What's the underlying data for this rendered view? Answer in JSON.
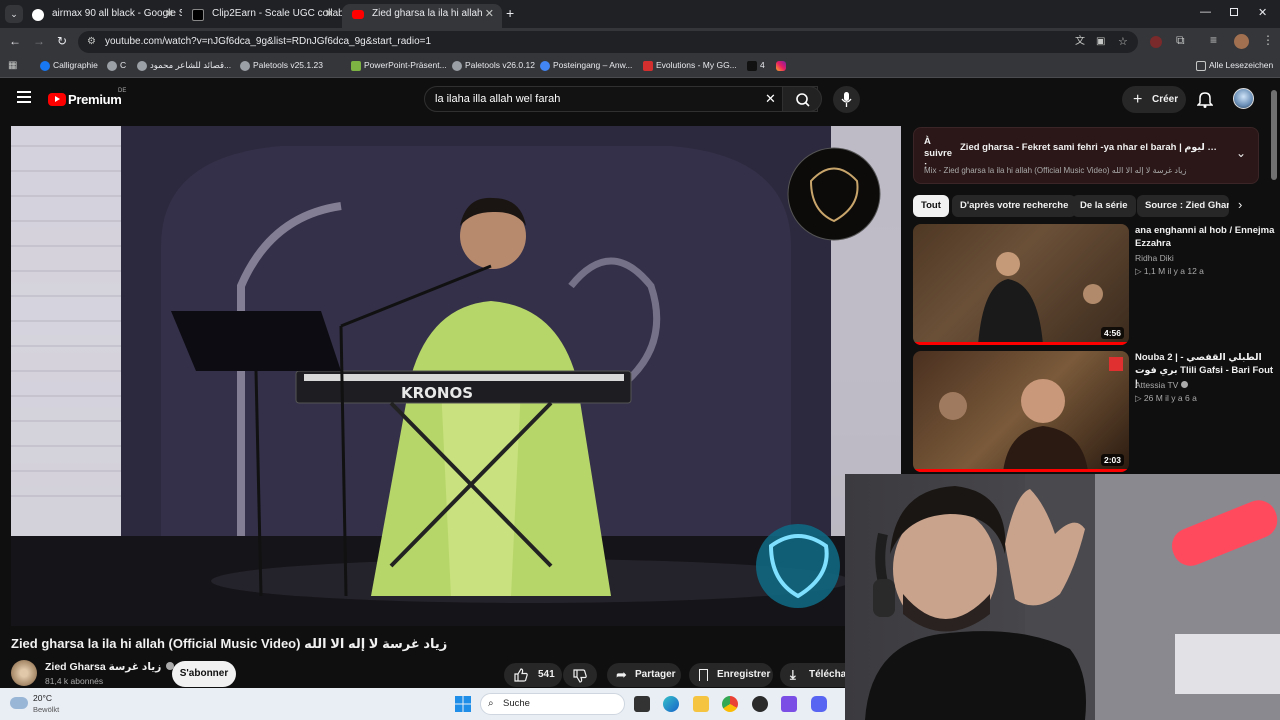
{
  "tabs": [
    {
      "title": "airmax 90 all black - Google Su",
      "favicon": "google-icon"
    },
    {
      "title": "Clip2Earn - Scale UGC collabora",
      "favicon": "clip2earn-icon"
    },
    {
      "title": "Zied gharsa la ila hi allah (Offici",
      "favicon": "youtube-icon"
    }
  ],
  "address": {
    "url": "youtube.com/watch?v=nJGf6dca_9g&list=RDnJGf6dca_9g&start_radio=1"
  },
  "bookmarks": [
    {
      "label": "Calligraphie",
      "icon": "facebook-icon"
    },
    {
      "label": "C",
      "icon": "globe-icon"
    },
    {
      "label": "قصائد للشاعر محمود...",
      "icon": "globe-icon"
    },
    {
      "label": "Paletools v25.1.23",
      "icon": "globe-icon"
    },
    {
      "label": "PowerPoint-Präsent...",
      "icon": "grid-icon"
    },
    {
      "label": "Paletools v26.0.12",
      "icon": "globe-icon"
    },
    {
      "label": "Posteingang – Anw...",
      "icon": "mail-icon"
    },
    {
      "label": "Evolutions - My GG...",
      "icon": "gg-icon"
    },
    {
      "label": "4",
      "icon": "bolt-icon"
    },
    {
      "label": "",
      "icon": "instagram-icon"
    }
  ],
  "bookmarks_all": "Alle Lesezeichen",
  "youtube": {
    "logo_text": "Premium",
    "region": "DE",
    "search_query": "la ilaha illa allah wel farah",
    "create_label": "Créer"
  },
  "video": {
    "title": "Zied gharsa la ila hi allah (Official Music Video) زياد غرسة لا إله الا الله",
    "keyboard_brand": "KRONOS",
    "channel": "Zied Gharsa زياد غرسة",
    "subscribers": "81,4 k abonnés",
    "subscribe_label": "S'abonner",
    "likes": "541",
    "share_label": "Partager",
    "save_label": "Enregistrer",
    "download_label": "Téléchar"
  },
  "upnext": {
    "prefix": "À suivre :",
    "title": "Zied gharsa - Fekret sami fehri -ya nhar el barah | الفارح يا ليلي ليوم...",
    "subtitle": "Mix - Zied gharsa la ila hi allah (Official Music Video) زياد غرسة لا إله الا الله"
  },
  "chips": [
    "Tout",
    "D'après votre recherche",
    "De la série",
    "Source : Zied Gharsa"
  ],
  "recommendations": [
    {
      "title": "ana enghanni al hob / Ennejma Ezzahra",
      "channel": "Ridha Diki",
      "stats": "1,1 M  il y a 12 a",
      "duration": "4:56"
    },
    {
      "title": "Nouba 2 | الطبلي القفصي - بري فوت Tlili Gafsi - Bari Fout |",
      "channel": "Attessia TV",
      "stats": "26 M  il y a 6 a",
      "duration": "2:03"
    }
  ],
  "taskbar": {
    "temp": "20°C",
    "weather": "Bewölkt",
    "search_label": "Suche"
  },
  "colors": {
    "youtube_red": "#ff0000",
    "chrome_dark": "#202124",
    "toolbar": "#35363a"
  }
}
